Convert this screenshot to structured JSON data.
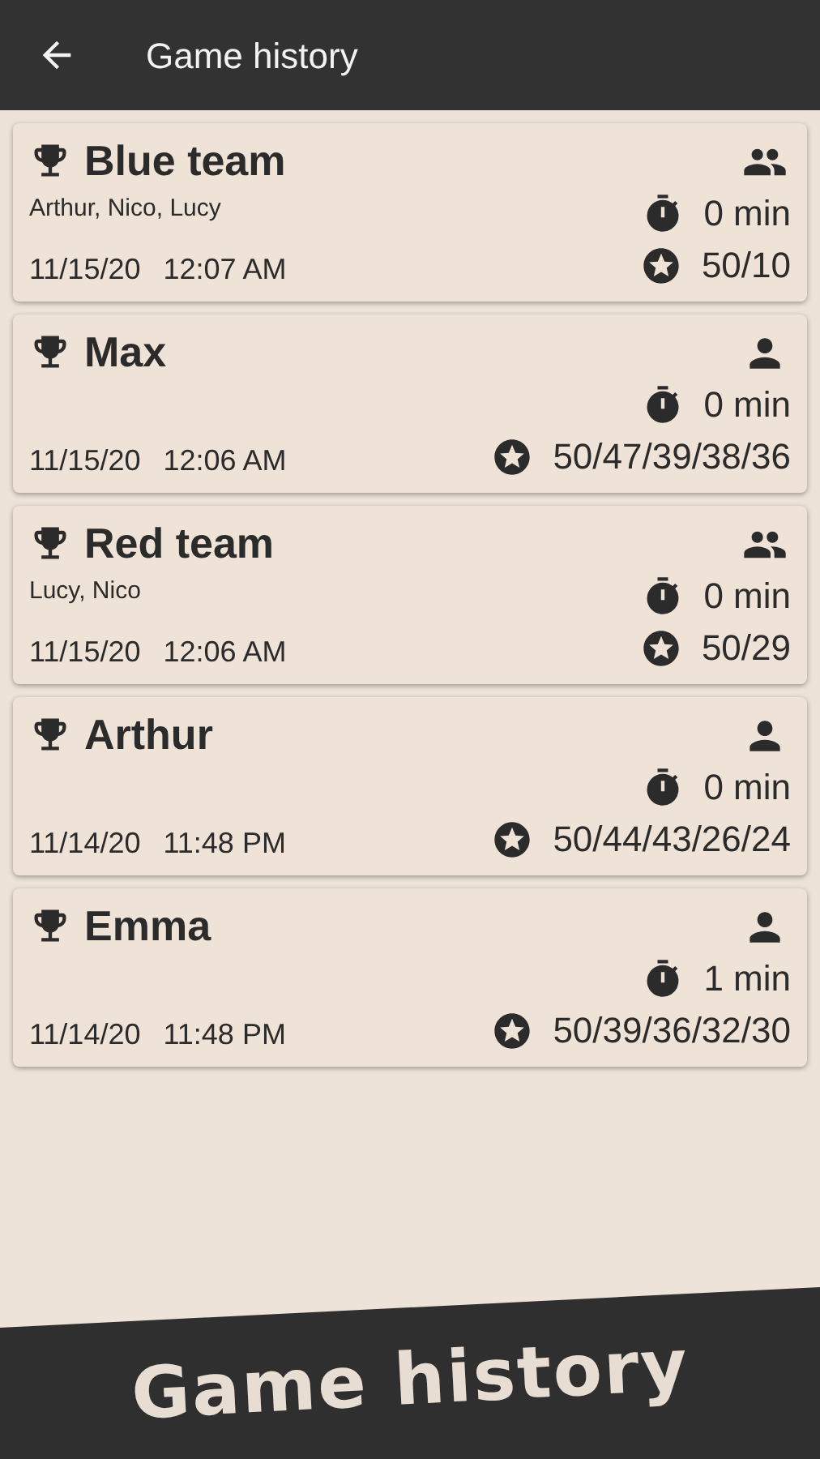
{
  "app_bar": {
    "title": "Game history"
  },
  "games": [
    {
      "kind": "team",
      "name": "Blue team",
      "members": "Arthur, Nico, Lucy",
      "duration": "0 min",
      "date": "11/15/20",
      "time": "12:07 AM",
      "scores": "50/10"
    },
    {
      "kind": "solo",
      "name": "Max",
      "duration": "0 min",
      "date": "11/15/20",
      "time": "12:06 AM",
      "scores": "50/47/39/38/36"
    },
    {
      "kind": "team",
      "name": "Red team",
      "members": "Lucy, Nico",
      "duration": "0 min",
      "date": "11/15/20",
      "time": "12:06 AM",
      "scores": "50/29"
    },
    {
      "kind": "solo",
      "name": "Arthur",
      "duration": "0 min",
      "date": "11/14/20",
      "time": "11:48 PM",
      "scores": "50/44/43/26/24"
    },
    {
      "kind": "solo",
      "name": "Emma",
      "duration": "1 min",
      "date": "11/14/20",
      "time": "11:48 PM",
      "scores": "50/39/36/32/30"
    }
  ],
  "banner": {
    "caption": "Game history"
  }
}
